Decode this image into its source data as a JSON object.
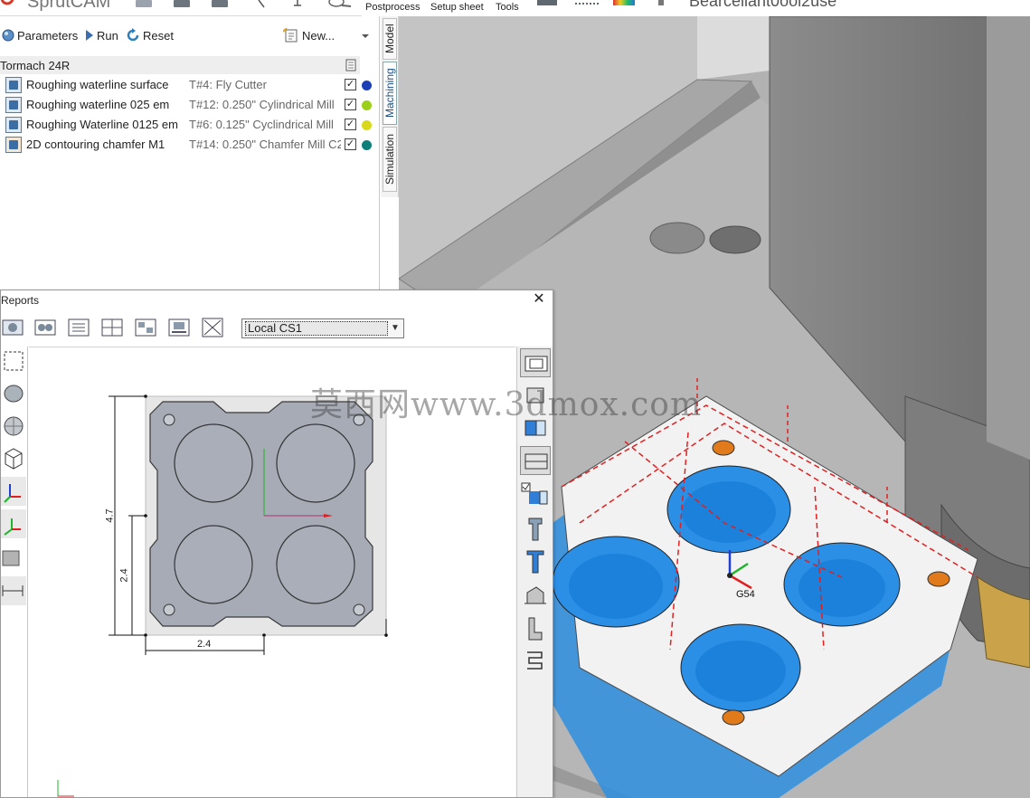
{
  "ribbon": {
    "app_title": "SprutCAM",
    "items": [
      {
        "label": "Postprocess"
      },
      {
        "label": "Setup sheet"
      },
      {
        "label": "Tools"
      }
    ],
    "project_title": "Bearcellant0ool2use"
  },
  "toolbar": {
    "parameters_label": "Parameters",
    "run_label": "Run",
    "reset_label": "Reset",
    "new_label": "New..."
  },
  "tree": {
    "root_label": "Tormach 24R",
    "operations": [
      {
        "name": "Roughing waterline surface",
        "tool": "T#4: Fly Cutter",
        "dot_color": "#1c3fb5"
      },
      {
        "name": "Roughing waterline 025 em",
        "tool": "T#12: 0.250\" Cylindrical Mill",
        "dot_color": "#9ccf1c"
      },
      {
        "name": "Roughing Waterline 0125 em",
        "tool": "T#6: 0.125\" Cyclindrical Mill",
        "dot_color": "#d8d81c"
      },
      {
        "name": "2D contouring chamfer M1",
        "tool": "T#14: 0.250\" Chamfer Mill C2",
        "dot_color": "#0f7f7a"
      }
    ]
  },
  "vtabs": {
    "model": "Model",
    "machining": "Machining",
    "simulation": "Simulation"
  },
  "reports": {
    "title": "Reports",
    "cs_value": "Local CS1"
  },
  "drawing": {
    "dim_height": "4.7",
    "dim_half_height": "2.4",
    "dim_half_width": "2.4"
  },
  "viewport": {
    "cs_label": "G54"
  },
  "watermark": "莫西网www.3dmox.com"
}
